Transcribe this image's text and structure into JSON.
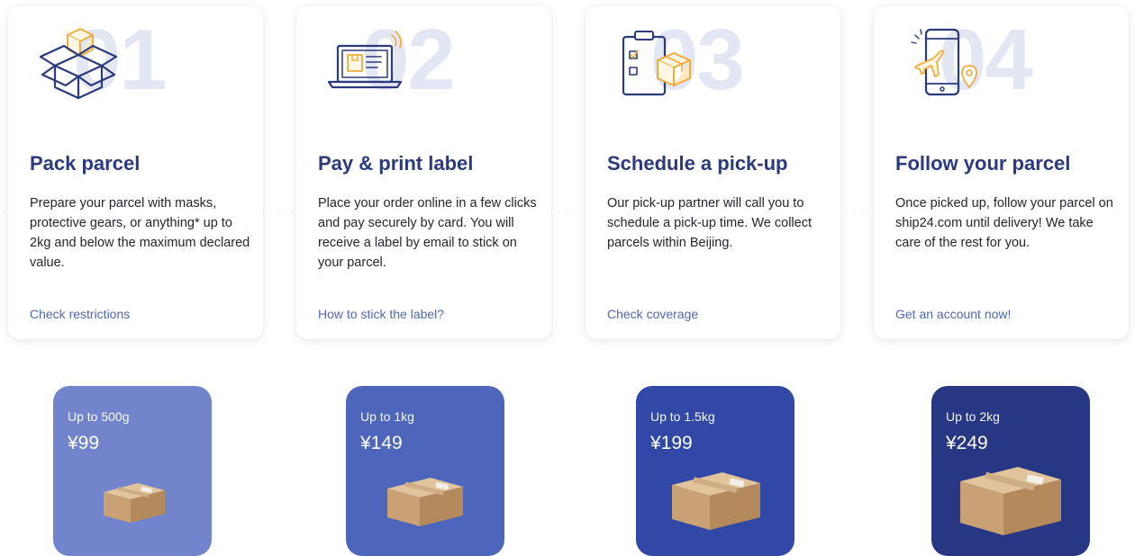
{
  "steps": [
    {
      "number": "01",
      "title": "Pack parcel",
      "description": "Prepare your parcel with masks, protective gears, or anything* up to 2kg and below the maximum declared value.",
      "link": "Check restrictions",
      "icon": "open-box-icon"
    },
    {
      "number": "02",
      "title": "Pay & print label",
      "description": "Place your order online in a few clicks and pay securely by card. You will receive a label by email to stick on your parcel.",
      "link": "How to stick the label?",
      "icon": "laptop-label-icon"
    },
    {
      "number": "03",
      "title": "Schedule a pick-up",
      "description": "Our pick-up partner will call you to schedule a pick-up time. We collect parcels within Beijing.",
      "link": "Check coverage",
      "icon": "clipboard-box-icon"
    },
    {
      "number": "04",
      "title": "Follow your parcel",
      "description": "Once picked up, follow your parcel on ship24.com until delivery! We take care of the rest for you.",
      "link": "Get an account now!",
      "icon": "phone-plane-icon"
    }
  ],
  "pricing": [
    {
      "weight": "Up to 500g",
      "price": "¥99",
      "color": "#7184cc"
    },
    {
      "weight": "Up to 1kg",
      "price": "¥149",
      "color": "#4d66bc"
    },
    {
      "weight": "Up to 1.5kg",
      "price": "¥199",
      "color": "#3248a6"
    },
    {
      "weight": "Up to 2kg",
      "price": "¥249",
      "color": "#283783"
    }
  ],
  "colors": {
    "navy": "#2a3a7c",
    "link": "#4f68b6",
    "orange": "#f0ad3c",
    "number": "#e3e7f3"
  }
}
